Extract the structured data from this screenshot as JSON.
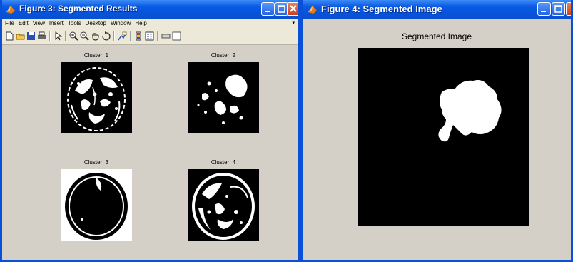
{
  "figure3": {
    "title": "Figure 3: Segmented Results",
    "menu": [
      "File",
      "Edit",
      "View",
      "Insert",
      "Tools",
      "Desktop",
      "Window",
      "Help"
    ],
    "menu_arrow": "▾",
    "toolbar_icons": [
      "new-icon",
      "open-icon",
      "save-icon",
      "print-icon",
      "pointer-icon",
      "zoom-in-icon",
      "zoom-out-icon",
      "pan-icon",
      "rotate-icon",
      "data-cursor-icon",
      "colorbar-icon",
      "legend-icon",
      "hide-tools-icon",
      "show-tools-icon"
    ],
    "panels": [
      {
        "title": "Cluster: 1"
      },
      {
        "title": "Cluster: 2"
      },
      {
        "title": "Cluster: 3"
      },
      {
        "title": "Cluster: 4"
      }
    ]
  },
  "figure4": {
    "title": "Figure 4: Segmented Image",
    "axes_title": "Segmented Image"
  },
  "colors": {
    "titlebar": "#0a5ae4",
    "window_bg": "#d4d0c8",
    "menubar_bg": "#ece9d8",
    "close_button": "#c8401c"
  }
}
